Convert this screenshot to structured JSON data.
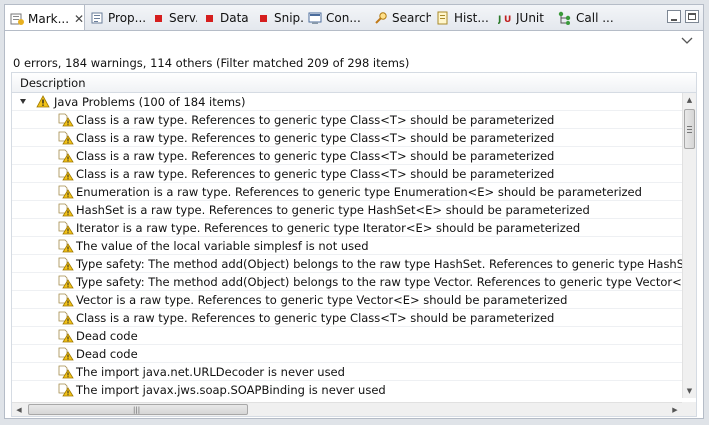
{
  "tabs": [
    {
      "label": "Mark...",
      "icon": "markers-icon",
      "active": true,
      "closable": true
    },
    {
      "label": "Prop...",
      "icon": "properties-icon"
    },
    {
      "label": "Serv...",
      "icon": "servers-icon"
    },
    {
      "label": "Data ...",
      "icon": "data-icon"
    },
    {
      "label": "Snip...",
      "icon": "snippets-icon"
    },
    {
      "label": "Con...",
      "icon": "console-icon"
    },
    {
      "label": "Search",
      "icon": "search-icon"
    },
    {
      "label": "Hist...",
      "icon": "history-icon"
    },
    {
      "label": "JUnit",
      "icon": "junit-icon"
    },
    {
      "label": "Call ...",
      "icon": "call-hierarchy-icon"
    }
  ],
  "summary": "0 errors, 184 warnings, 114 others (Filter matched 209 of 298 items)",
  "table": {
    "column_header": "Description",
    "group_label": "Java Problems (100 of 184 items)",
    "items": [
      "Class is a raw type. References to generic type Class<T> should be parameterized",
      "Class is a raw type. References to generic type Class<T> should be parameterized",
      "Class is a raw type. References to generic type Class<T> should be parameterized",
      "Class is a raw type. References to generic type Class<T> should be parameterized",
      "Enumeration is a raw type. References to generic type Enumeration<E> should be parameterized",
      "HashSet is a raw type. References to generic type HashSet<E> should be parameterized",
      "Iterator is a raw type. References to generic type Iterator<E> should be parameterized",
      "The value of the local variable simplesf is not used",
      "Type safety: The method add(Object) belongs to the raw type HashSet. References to generic type HashSet<E> shou",
      "Type safety: The method add(Object) belongs to the raw type Vector. References to generic type Vector<E> should",
      "Vector is a raw type. References to generic type Vector<E> should be parameterized",
      "Class is a raw type. References to generic type Class<T> should be parameterized",
      "Dead code",
      "Dead code",
      "The import java.net.URLDecoder is never used",
      "The import javax.jws.soap.SOAPBinding is never used"
    ]
  },
  "colors": {
    "warning": "#f2c218",
    "selection_border": "#b5bcc7"
  }
}
